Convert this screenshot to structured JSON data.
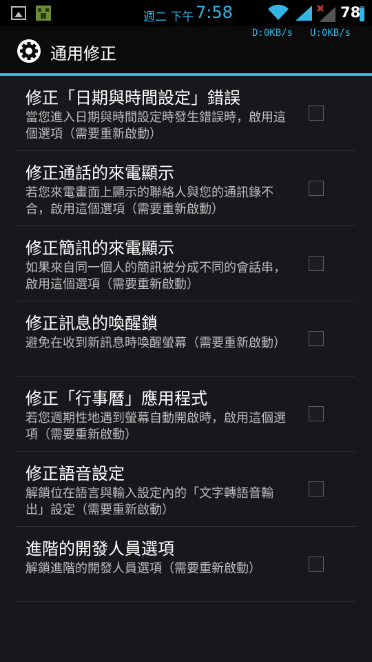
{
  "status_bar": {
    "day": "週二 下午",
    "time": "7:58",
    "battery": "78",
    "accent": "#33b5e5"
  },
  "action_bar": {
    "title": "通用修正",
    "download_speed": "D:0KB/s",
    "upload_speed": "U:0KB/s",
    "icon": "gear-icon"
  },
  "settings": [
    {
      "title": "修正「日期與時間設定」錯誤",
      "summary": "當您進入日期與時間設定時發生錯誤時，啟用這個選項（需要重新啟動）",
      "checked": false
    },
    {
      "title": "修正通話的來電顯示",
      "summary": "若您來電畫面上顯示的聯絡人與您的通訊錄不合，啟用這個選項（需要重新啟動）",
      "checked": false
    },
    {
      "title": "修正簡訊的來電顯示",
      "summary": "如果來自同一個人的簡訊被分成不同的會話串，啟用這個選項（需要重新啟動）",
      "checked": false
    },
    {
      "title": "修正訊息的喚醒鎖",
      "summary": "避免在收到新訊息時喚醒螢幕（需要重新啟動）",
      "checked": false
    },
    {
      "title": "修正「行事曆」應用程式",
      "summary": "若您週期性地遇到螢幕自動開啟時，啟用這個選項（需要重新啟動）",
      "checked": false
    },
    {
      "title": "修正語音設定",
      "summary": "解鎖位在語言與輸入設定內的「文字轉語音輸出」設定（需要重新啟動）",
      "checked": false
    },
    {
      "title": "進階的開發人員選項",
      "summary": "解鎖進階的開發人員選項（需要重新啟動）",
      "checked": false
    }
  ]
}
